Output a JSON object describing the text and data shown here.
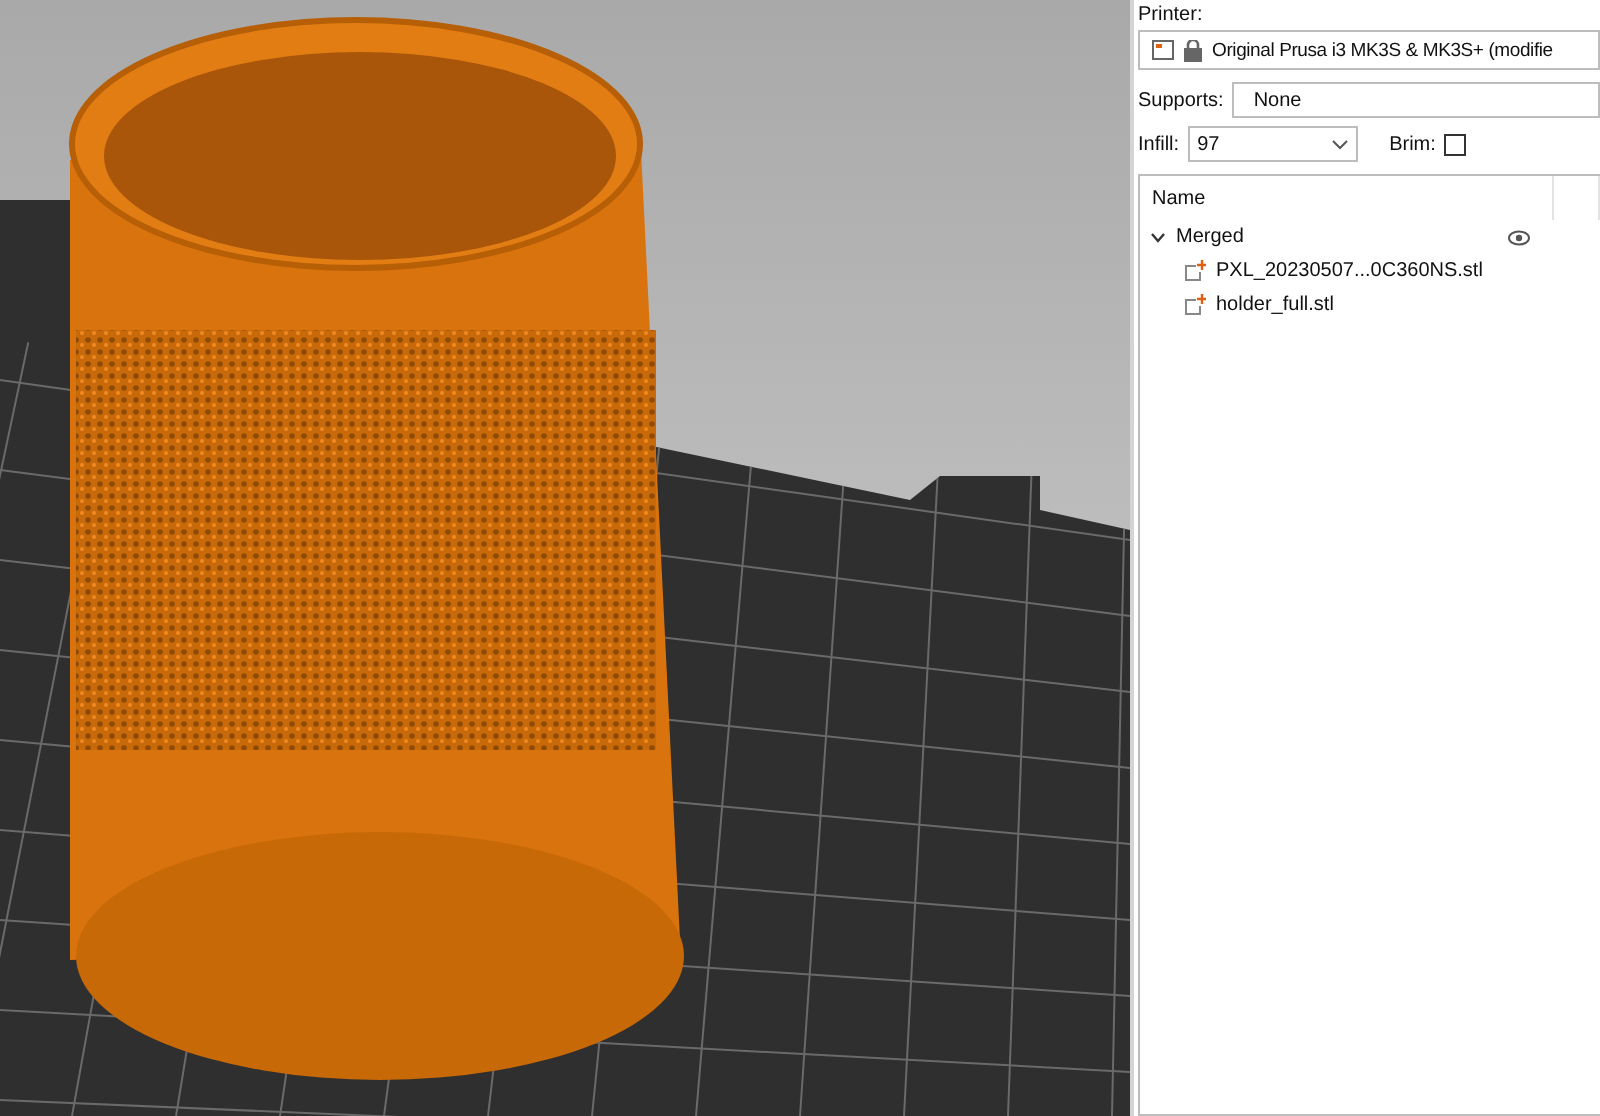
{
  "printer": {
    "label": "Printer:",
    "value": "Original Prusa i3 MK3S & MK3S+ (modifie"
  },
  "supports": {
    "label": "Supports:",
    "value": "None"
  },
  "infill": {
    "label": "Infill:",
    "value": "97"
  },
  "brim": {
    "label": "Brim:",
    "checked": false
  },
  "object_list": {
    "columns": [
      "Name"
    ],
    "items": [
      {
        "name": "Merged",
        "expanded": true,
        "visible": true,
        "children": [
          {
            "name": "PXL_20230507...0C360NS.stl"
          },
          {
            "name": "holder_full.stl"
          }
        ]
      }
    ]
  }
}
